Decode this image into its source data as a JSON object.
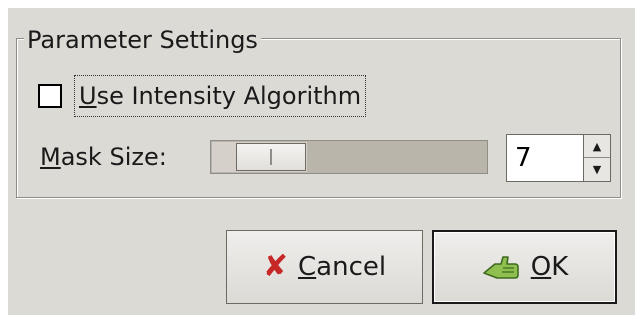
{
  "frame": {
    "title": "Parameter Settings"
  },
  "checkbox": {
    "mnemonic": "U",
    "rest": "se Intensity Algorithm",
    "checked": false
  },
  "mask": {
    "mnemonic": "M",
    "rest": "ask Size:"
  },
  "slider": {
    "level_fraction": 0.2
  },
  "spin": {
    "value": "7",
    "up_glyph": "▲",
    "down_glyph": "▼"
  },
  "buttons": {
    "cancel": {
      "icon": "cancel-x-icon",
      "mnemonic": "C",
      "rest": "ancel"
    },
    "ok": {
      "icon": "ok-hand-icon",
      "mnemonic": "O",
      "rest": "K"
    }
  },
  "colors": {
    "dialog_bg": "#dcdad5",
    "cancel_icon": "#c62828",
    "ok_icon": "#6a9a3a"
  }
}
